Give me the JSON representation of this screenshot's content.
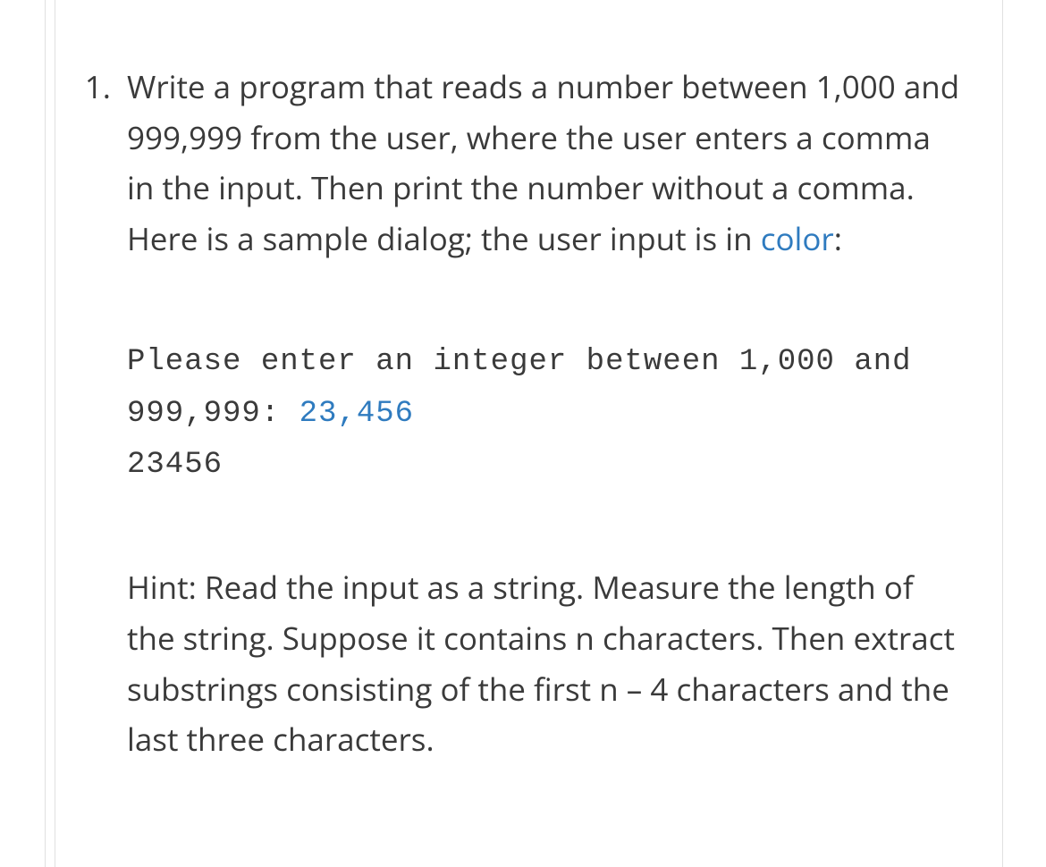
{
  "problem": {
    "number": "1.",
    "description_part1": "Write a program that reads a number between 1,000 and 999,999 from the user, where the user enters a comma in the input. Then print the number without a comma. Here is a sample dialog; the user input is in ",
    "description_link": "color",
    "description_part2": ":",
    "code_line1_prefix": "Please enter an integer between 1,000 and 999,999: ",
    "code_line1_input": "23,456",
    "code_line2": "23456",
    "hint": "Hint: Read the input as a string. Measure the length of the string. Suppose it contains n characters. Then extract substrings consisting of the first n – 4 characters and the last three characters."
  }
}
